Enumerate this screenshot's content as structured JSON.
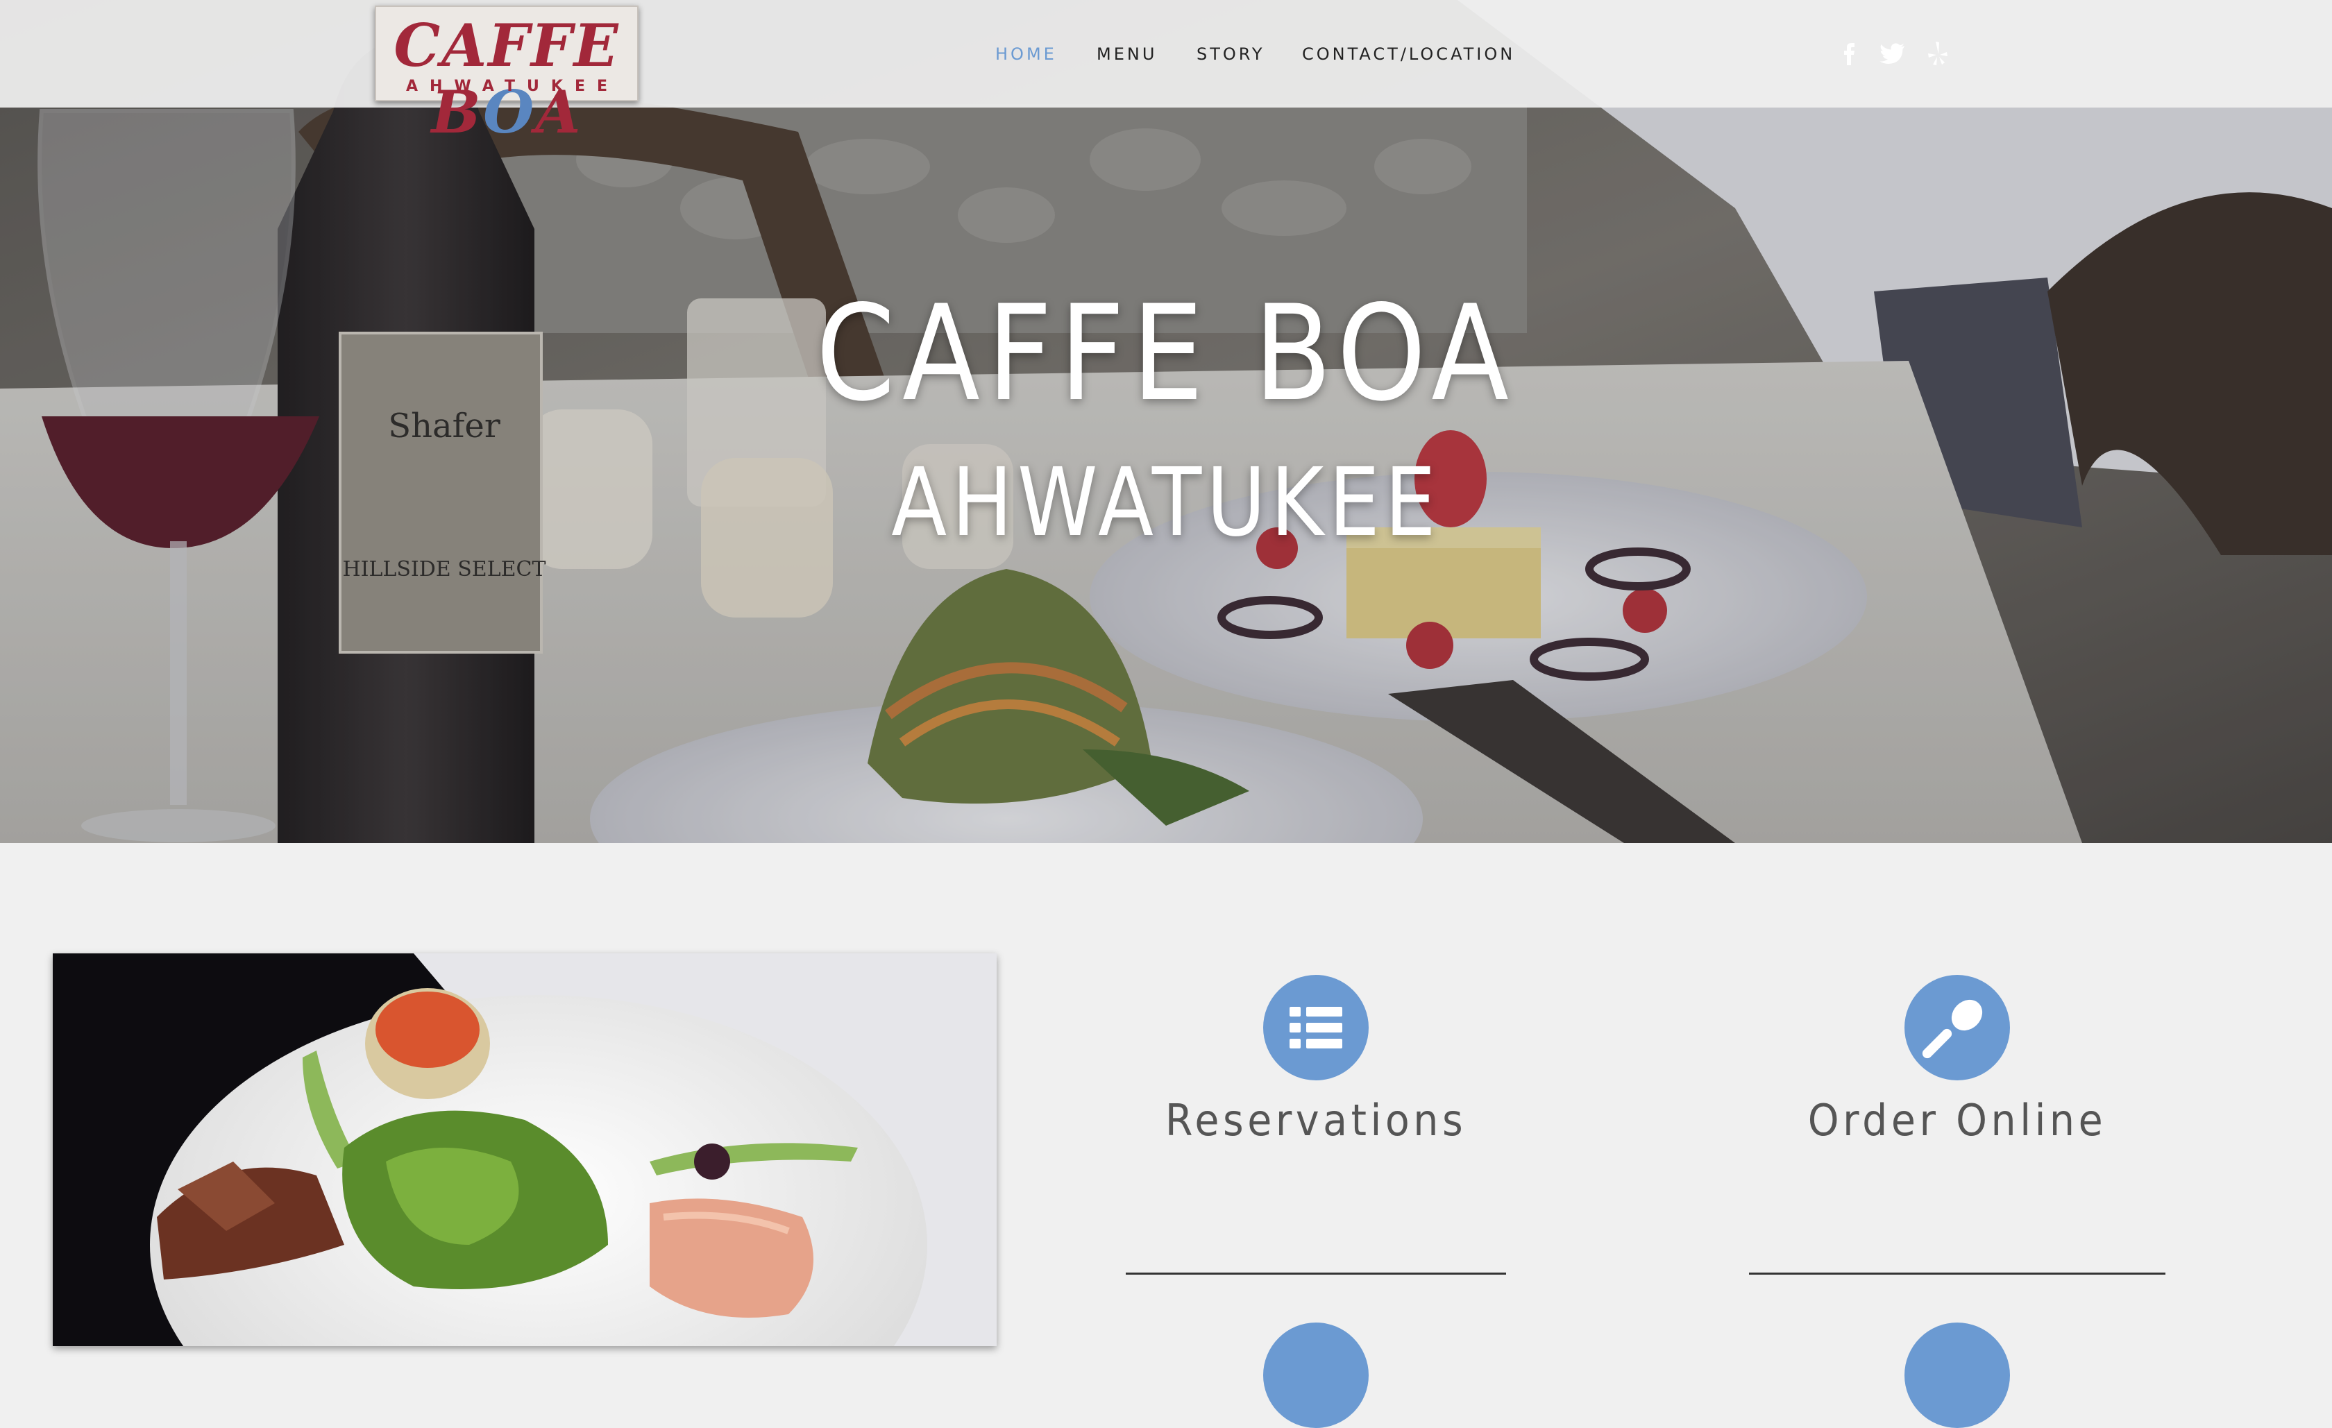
{
  "brand": {
    "logo_main": "CAFFE BOA",
    "logo_sub": "AHWATUKEE"
  },
  "nav": {
    "items": [
      {
        "label": "HOME",
        "active": true
      },
      {
        "label": "MENU",
        "active": false
      },
      {
        "label": "STORY",
        "active": false
      },
      {
        "label": "CONTACT/LOCATION",
        "active": false
      }
    ],
    "social": [
      {
        "icon": "facebook-icon"
      },
      {
        "icon": "twitter-icon"
      },
      {
        "icon": "yelp-icon"
      }
    ]
  },
  "hero": {
    "title": "CAFFE BOA",
    "subtitle": "AHWATUKEE",
    "bottle_label": "Shafer",
    "bottle_label_2": "HILLSIDE SELECT"
  },
  "features": [
    {
      "label": "Reservations",
      "icon": "list-icon"
    },
    {
      "label": "Order Online",
      "icon": "spoon-icon"
    }
  ],
  "colors": {
    "accent": "#6b9ad2",
    "logo_red": "#a2283a",
    "background": "#f0f0f0"
  }
}
